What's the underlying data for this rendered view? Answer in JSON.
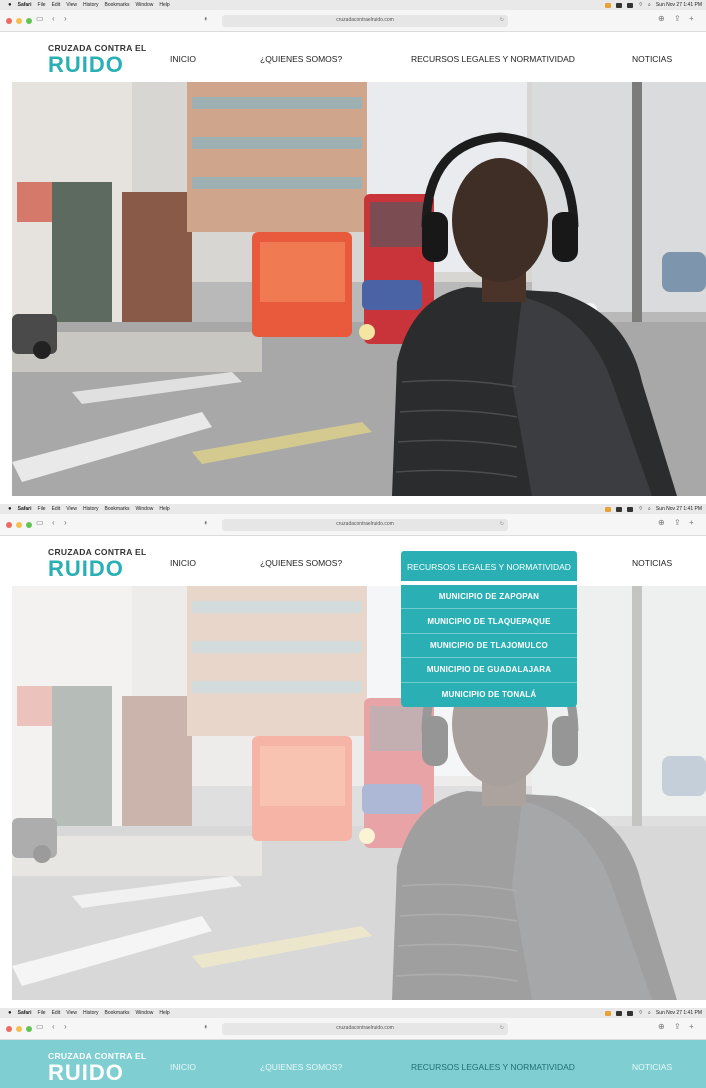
{
  "menubar": {
    "app": "Safari",
    "items": [
      "File",
      "Edit",
      "View",
      "History",
      "Bookmarks",
      "Window",
      "Help"
    ],
    "clock": "Sun Nov 27 1:41 PM"
  },
  "browser": {
    "url": "cruzadacontraelruido.com"
  },
  "logo": {
    "top": "CRUZADA CONTRA EL",
    "big": "RUIDO"
  },
  "nav": [
    "INICIO",
    "¿QUIENES SOMOS?",
    "RECURSOS LEGALES Y NORMATIVIDAD",
    "NOTICIAS"
  ],
  "dropdown": {
    "items": [
      "MUNICIPIO DE ZAPOPAN",
      "MUNICIPIO DE TLAQUEPAQUE",
      "MUNICIPIO DE TLAJOMULCO",
      "MUNICIPIO DE GUADALAJARA",
      "MUNICIPIO DE TONALÁ"
    ]
  },
  "colors": {
    "brand": "#2ab0b4",
    "teal_header": "#7fcfd2"
  }
}
